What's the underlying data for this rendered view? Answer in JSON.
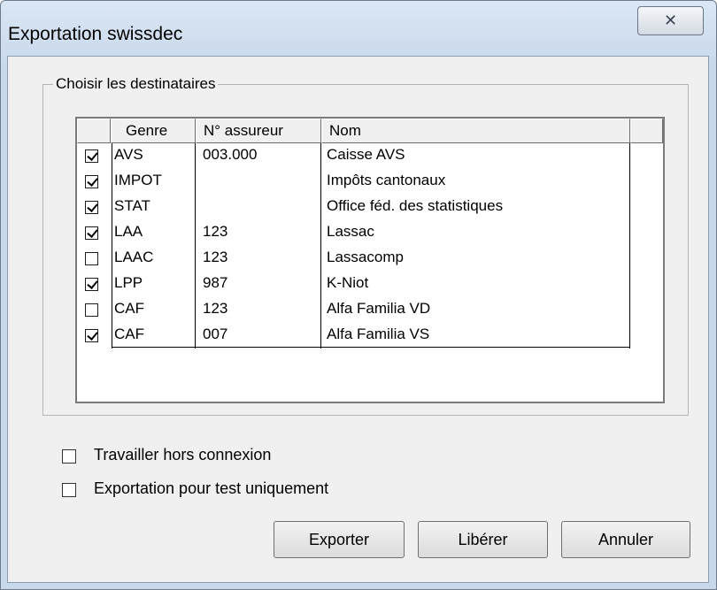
{
  "window": {
    "title": "Exportation swissdec",
    "close_glyph": "✕"
  },
  "group": {
    "legend": "Choisir les destinataires"
  },
  "table": {
    "columns": [
      "Genre",
      "N° assureur",
      "Nom"
    ],
    "rows": [
      {
        "checked": true,
        "genre": "AVS",
        "numero": "003.000",
        "nom": "Caisse AVS"
      },
      {
        "checked": true,
        "genre": "IMPOT",
        "numero": "",
        "nom": "Impôts cantonaux"
      },
      {
        "checked": true,
        "genre": "STAT",
        "numero": "",
        "nom": "Office féd. des statistiques"
      },
      {
        "checked": true,
        "genre": "LAA",
        "numero": "123",
        "nom": "Lassac"
      },
      {
        "checked": false,
        "genre": "LAAC",
        "numero": "123",
        "nom": "Lassacomp"
      },
      {
        "checked": true,
        "genre": "LPP",
        "numero": "987",
        "nom": "K-Niot"
      },
      {
        "checked": false,
        "genre": "CAF",
        "numero": "123",
        "nom": "Alfa Familia VD"
      },
      {
        "checked": true,
        "genre": "CAF",
        "numero": "007",
        "nom": "Alfa Familia VS"
      }
    ]
  },
  "options": {
    "offline": {
      "label": "Travailler hors connexion",
      "checked": false
    },
    "test_only": {
      "label": "Exportation pour test uniquement",
      "checked": false
    }
  },
  "buttons": {
    "export": "Exporter",
    "release": "Libérer",
    "cancel": "Annuler"
  }
}
